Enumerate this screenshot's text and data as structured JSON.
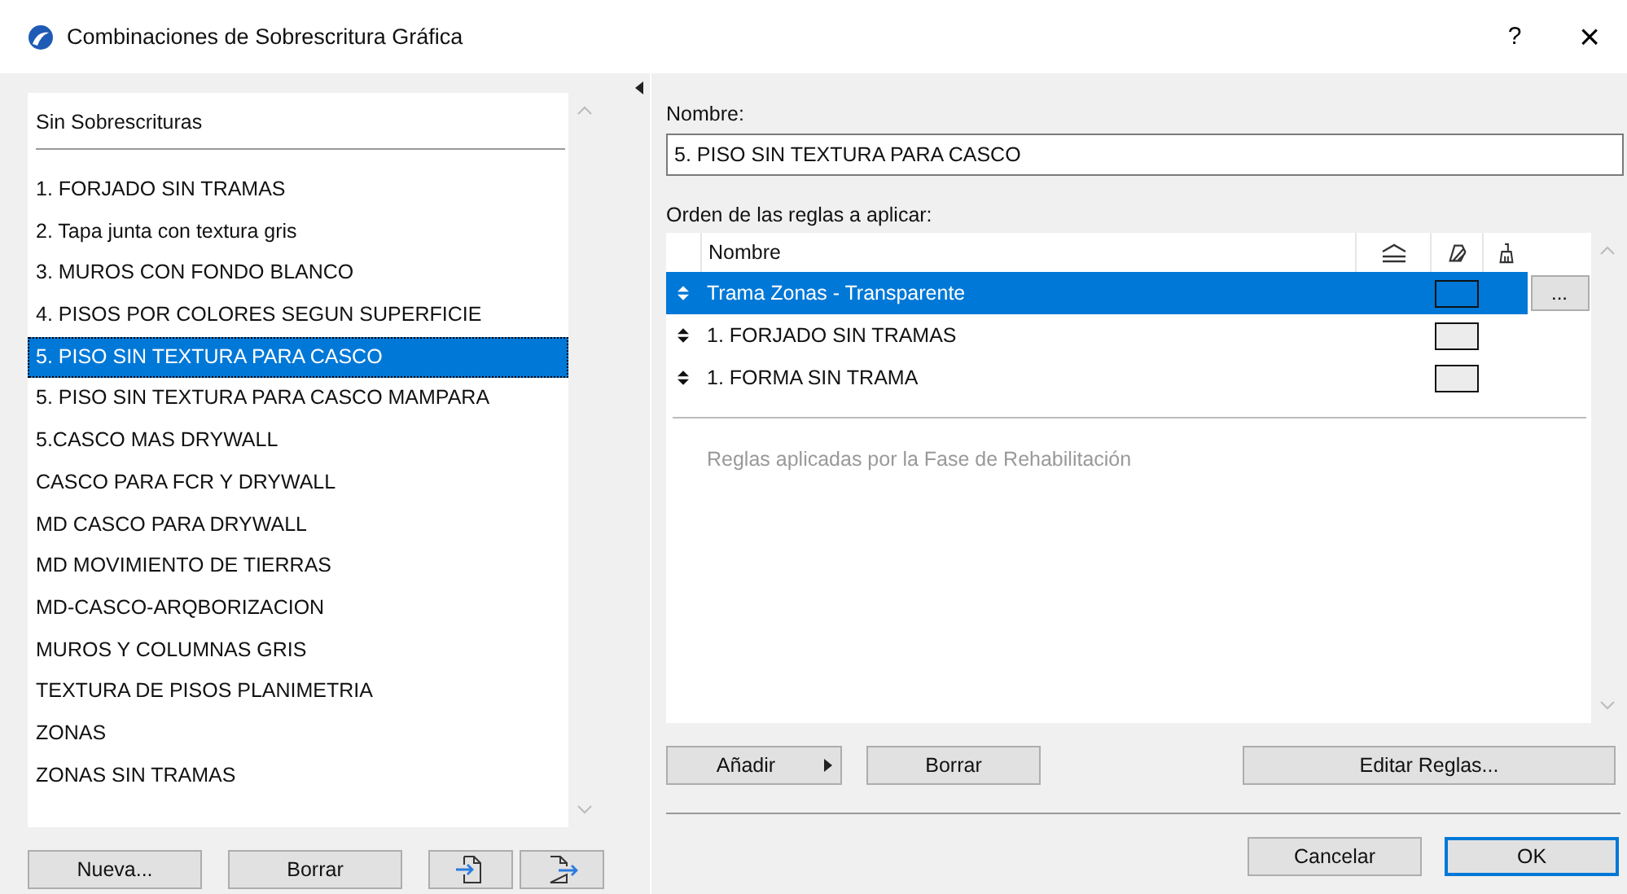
{
  "window": {
    "title": "Combinaciones de Sobrescritura Gráfica",
    "help": "?",
    "close": "×"
  },
  "list": {
    "header": "Sin Sobrescrituras",
    "items": [
      {
        "label": "1. FORJADO SIN TRAMAS",
        "selected": false
      },
      {
        "label": "2. Tapa junta con textura gris",
        "selected": false
      },
      {
        "label": "3. MUROS CON FONDO BLANCO",
        "selected": false
      },
      {
        "label": "4. PISOS POR COLORES SEGUN SUPERFICIE",
        "selected": false
      },
      {
        "label": "5. PISO SIN TEXTURA PARA CASCO",
        "selected": true
      },
      {
        "label": "5. PISO SIN TEXTURA PARA CASCO MAMPARA",
        "selected": false
      },
      {
        "label": "5.CASCO MAS DRYWALL",
        "selected": false
      },
      {
        "label": "CASCO PARA FCR Y DRYWALL",
        "selected": false
      },
      {
        "label": "MD CASCO PARA DRYWALL",
        "selected": false
      },
      {
        "label": "MD MOVIMIENTO DE TIERRAS",
        "selected": false
      },
      {
        "label": "MD-CASCO-ARQBORIZACION",
        "selected": false
      },
      {
        "label": "MUROS Y COLUMNAS GRIS",
        "selected": false
      },
      {
        "label": "TEXTURA DE PISOS PLANIMETRIA",
        "selected": false
      },
      {
        "label": "ZONAS",
        "selected": false
      },
      {
        "label": "ZONAS SIN TRAMAS",
        "selected": false
      }
    ],
    "buttons": [
      "Nueva...",
      "Borrar"
    ]
  },
  "name_label": "Nombre:",
  "name_value": "5. PISO SIN TEXTURA PARA CASCO",
  "rules_label": "Orden de las reglas a aplicar:",
  "table": {
    "column_header": "Nombre",
    "rows": [
      {
        "name": "Trama Zonas - Transparente",
        "selected": true,
        "more": "..."
      },
      {
        "name": "1. FORJADO SIN TRAMAS",
        "selected": false
      },
      {
        "name": "1. FORMA SIN TRAMA",
        "selected": false
      }
    ],
    "footer_note": "Reglas aplicadas por la Fase de Rehabilitación"
  },
  "rule_buttons": {
    "add": "Añadir",
    "delete": "Borrar",
    "edit": "Editar Reglas..."
  },
  "dialog_buttons": {
    "cancel": "Cancelar",
    "ok": "OK"
  }
}
